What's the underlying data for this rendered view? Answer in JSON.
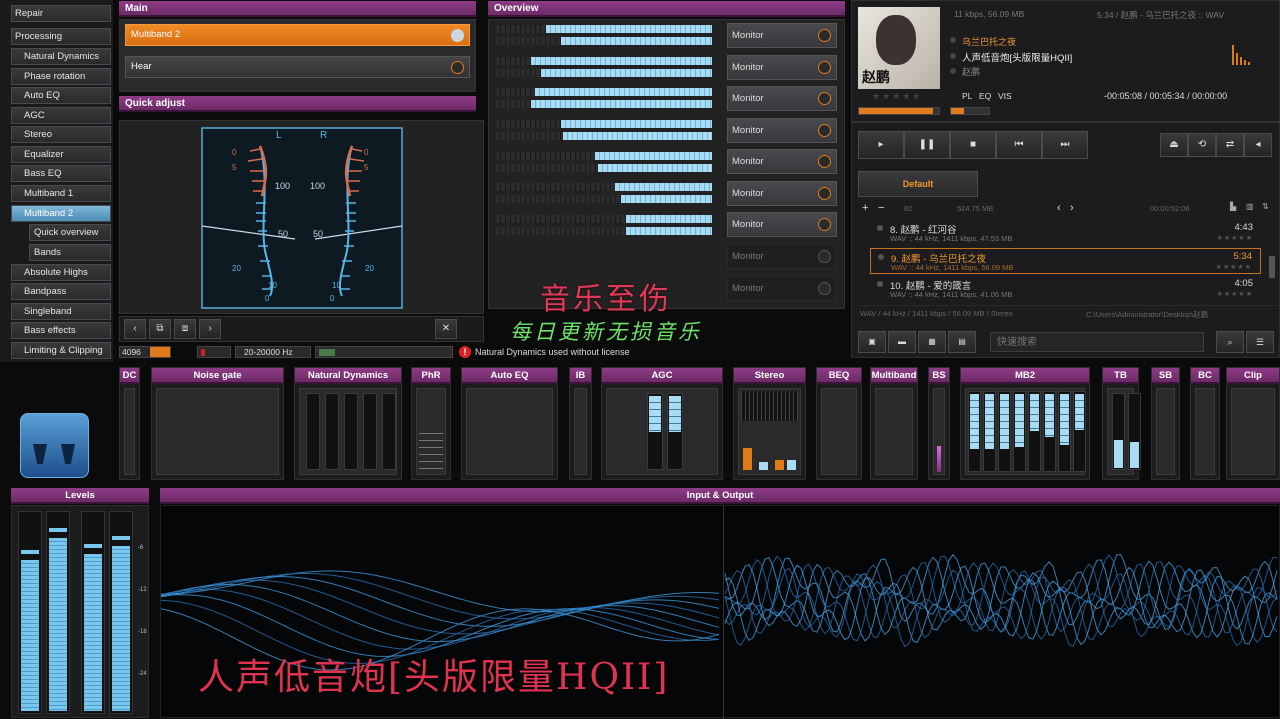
{
  "nav": {
    "repair": "Repair",
    "processing": "Processing",
    "items": [
      "Natural Dynamics",
      "Phase rotation",
      "Auto EQ",
      "AGC",
      "Stereo",
      "Equalizer",
      "Bass EQ",
      "Multiband 1",
      "Multiband 2"
    ],
    "subitems": [
      "Quick overview",
      "Bands"
    ],
    "items2": [
      "Absolute Highs",
      "Bandpass",
      "Singleband",
      "Bass effects",
      "Limiting & Clipping"
    ],
    "selected": "Multiband 2"
  },
  "main": {
    "header": "Main",
    "row1": "Multiband 2",
    "row2": "Hear"
  },
  "quick_adjust": {
    "header": "Quick adjust",
    "L": "L",
    "R": "R",
    "ticks_left": [
      "100",
      "50",
      "20",
      "10",
      "0"
    ],
    "ticks_right": [
      "100",
      "50",
      "20",
      "10",
      "0"
    ],
    "tick_inner_left": [
      "0",
      "5"
    ],
    "tick_inner_right": [
      "0",
      "5"
    ]
  },
  "status": {
    "val1": "4096",
    "freq": "20-20000 Hz",
    "warning": "Natural Dynamics used without license"
  },
  "overview": {
    "header": "Overview",
    "monitors": [
      "Monitor",
      "Monitor",
      "Monitor",
      "Monitor",
      "Monitor",
      "Monitor",
      "Monitor",
      "Monitor",
      "Monitor"
    ],
    "bar_levels": [
      [
        0.77,
        0.7
      ],
      [
        0.84,
        0.79
      ],
      [
        0.82,
        0.84
      ],
      [
        0.7,
        0.69
      ],
      [
        0.54,
        0.53
      ],
      [
        0.45,
        0.42
      ],
      [
        0.4,
        0.4
      ]
    ]
  },
  "overlay": {
    "line1": "音乐至伤",
    "line2": "每日更新无损音乐",
    "bottom": "人声低音炮[头版限量HQII]"
  },
  "player": {
    "info_top": "11 kbps, 56.09 MB",
    "info_top2": "5:34 / 赵鹏 - 乌兰巴托之夜 :: WAV",
    "song_title": "乌兰巴托之夜",
    "album": "人声低音炮[头版限量HQII]",
    "artist": "赵鹏",
    "tabs": [
      "PL",
      "EQ",
      "VIS"
    ],
    "time": "-00:05:08 / 00:05:34 / 00:00:00",
    "playlist_tab": "Default",
    "playlist_size": "524.75 MB",
    "playlist_time": "00:00:52:06",
    "count": "82",
    "tracks": [
      {
        "title": "8. 赵鹏 - 红河谷",
        "info": "WAV :: 44 kHz, 1411 kbps, 47.53 MB",
        "dur": "4:43",
        "current": false
      },
      {
        "title": "9. 赵鹏 - 乌兰巴托之夜",
        "info": "WAV :: 44 kHz, 1411 kbps, 56.09 MB",
        "dur": "5:34",
        "current": true
      },
      {
        "title": "10. 赵鹏 - 爱的箴言",
        "info": "WAV :: 44 kHz, 1411 kbps, 41.06 MB",
        "dur": "4:05",
        "current": false
      }
    ],
    "statusbar": "WAV / 44 kHz / 1411 kbps / 56.09 MB / Stereo",
    "path": "C:\\Users\\Administrator\\Desktop\\赵鹏",
    "search_placeholder": "快速搜索",
    "progress": 0.92,
    "volume": 0.35
  },
  "modules": [
    "DC",
    "Noise gate",
    "Natural Dynamics",
    "PhR",
    "Auto EQ",
    "IB",
    "AGC",
    "Stereo",
    "BEQ",
    "Multiband",
    "BS",
    "MB2",
    "TB",
    "SB",
    "BC",
    "Clip"
  ],
  "levels": {
    "header": "Levels",
    "scale": [
      "-6",
      "-12",
      "-18",
      "-24"
    ],
    "values": [
      0.76,
      0.87,
      0.79,
      0.83
    ]
  },
  "io": {
    "header": "Input & Output"
  },
  "colors": {
    "accent": "#e07b1a",
    "purple": "#7a3274",
    "meter": "#79c7ee"
  }
}
